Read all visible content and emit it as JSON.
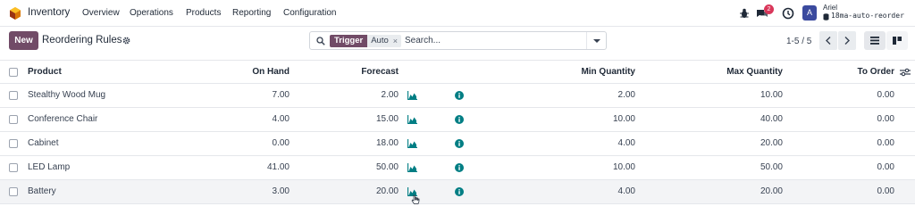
{
  "navbar": {
    "app_name": "Inventory",
    "menu": [
      "Overview",
      "Operations",
      "Products",
      "Reporting",
      "Configuration"
    ],
    "chat_badge": "2",
    "avatar_letter": "A",
    "user_name": "Ariel",
    "database": "18ma-auto-reorder"
  },
  "control": {
    "new_label": "New",
    "title": "Reordering Rules",
    "facet_label": "Trigger",
    "facet_value": "Auto",
    "facet_close": "×",
    "search_placeholder": "Search...",
    "pager": "1-5 / 5"
  },
  "table": {
    "headers": {
      "product": "Product",
      "on_hand": "On Hand",
      "forecast": "Forecast",
      "min_qty": "Min Quantity",
      "max_qty": "Max Quantity",
      "to_order": "To Order"
    },
    "rows": [
      {
        "product": "Stealthy Wood Mug",
        "on_hand": "7.00",
        "forecast": "2.00",
        "min_qty": "2.00",
        "max_qty": "10.00",
        "to_order": "0.00"
      },
      {
        "product": "Conference Chair",
        "on_hand": "4.00",
        "forecast": "15.00",
        "min_qty": "10.00",
        "max_qty": "40.00",
        "to_order": "0.00"
      },
      {
        "product": "Cabinet",
        "on_hand": "0.00",
        "forecast": "18.00",
        "min_qty": "4.00",
        "max_qty": "20.00",
        "to_order": "0.00"
      },
      {
        "product": "LED Lamp",
        "on_hand": "41.00",
        "forecast": "50.00",
        "min_qty": "10.00",
        "max_qty": "50.00",
        "to_order": "0.00"
      },
      {
        "product": "Battery",
        "on_hand": "3.00",
        "forecast": "20.00",
        "min_qty": "4.00",
        "max_qty": "20.00",
        "to_order": "0.00"
      }
    ]
  },
  "colors": {
    "brand": "#714b67",
    "info": "#017e84",
    "badge": "#d9375a",
    "avatar": "#3b4a9e"
  },
  "icons": [
    "inventory-logo-icon",
    "bug-icon",
    "chat-icon",
    "clock-icon",
    "database-icon",
    "gear-icon",
    "search-icon",
    "chevron-left-icon",
    "chevron-right-icon",
    "list-view-icon",
    "kanban-view-icon",
    "graph-icon",
    "info-icon",
    "column-settings-icon"
  ]
}
